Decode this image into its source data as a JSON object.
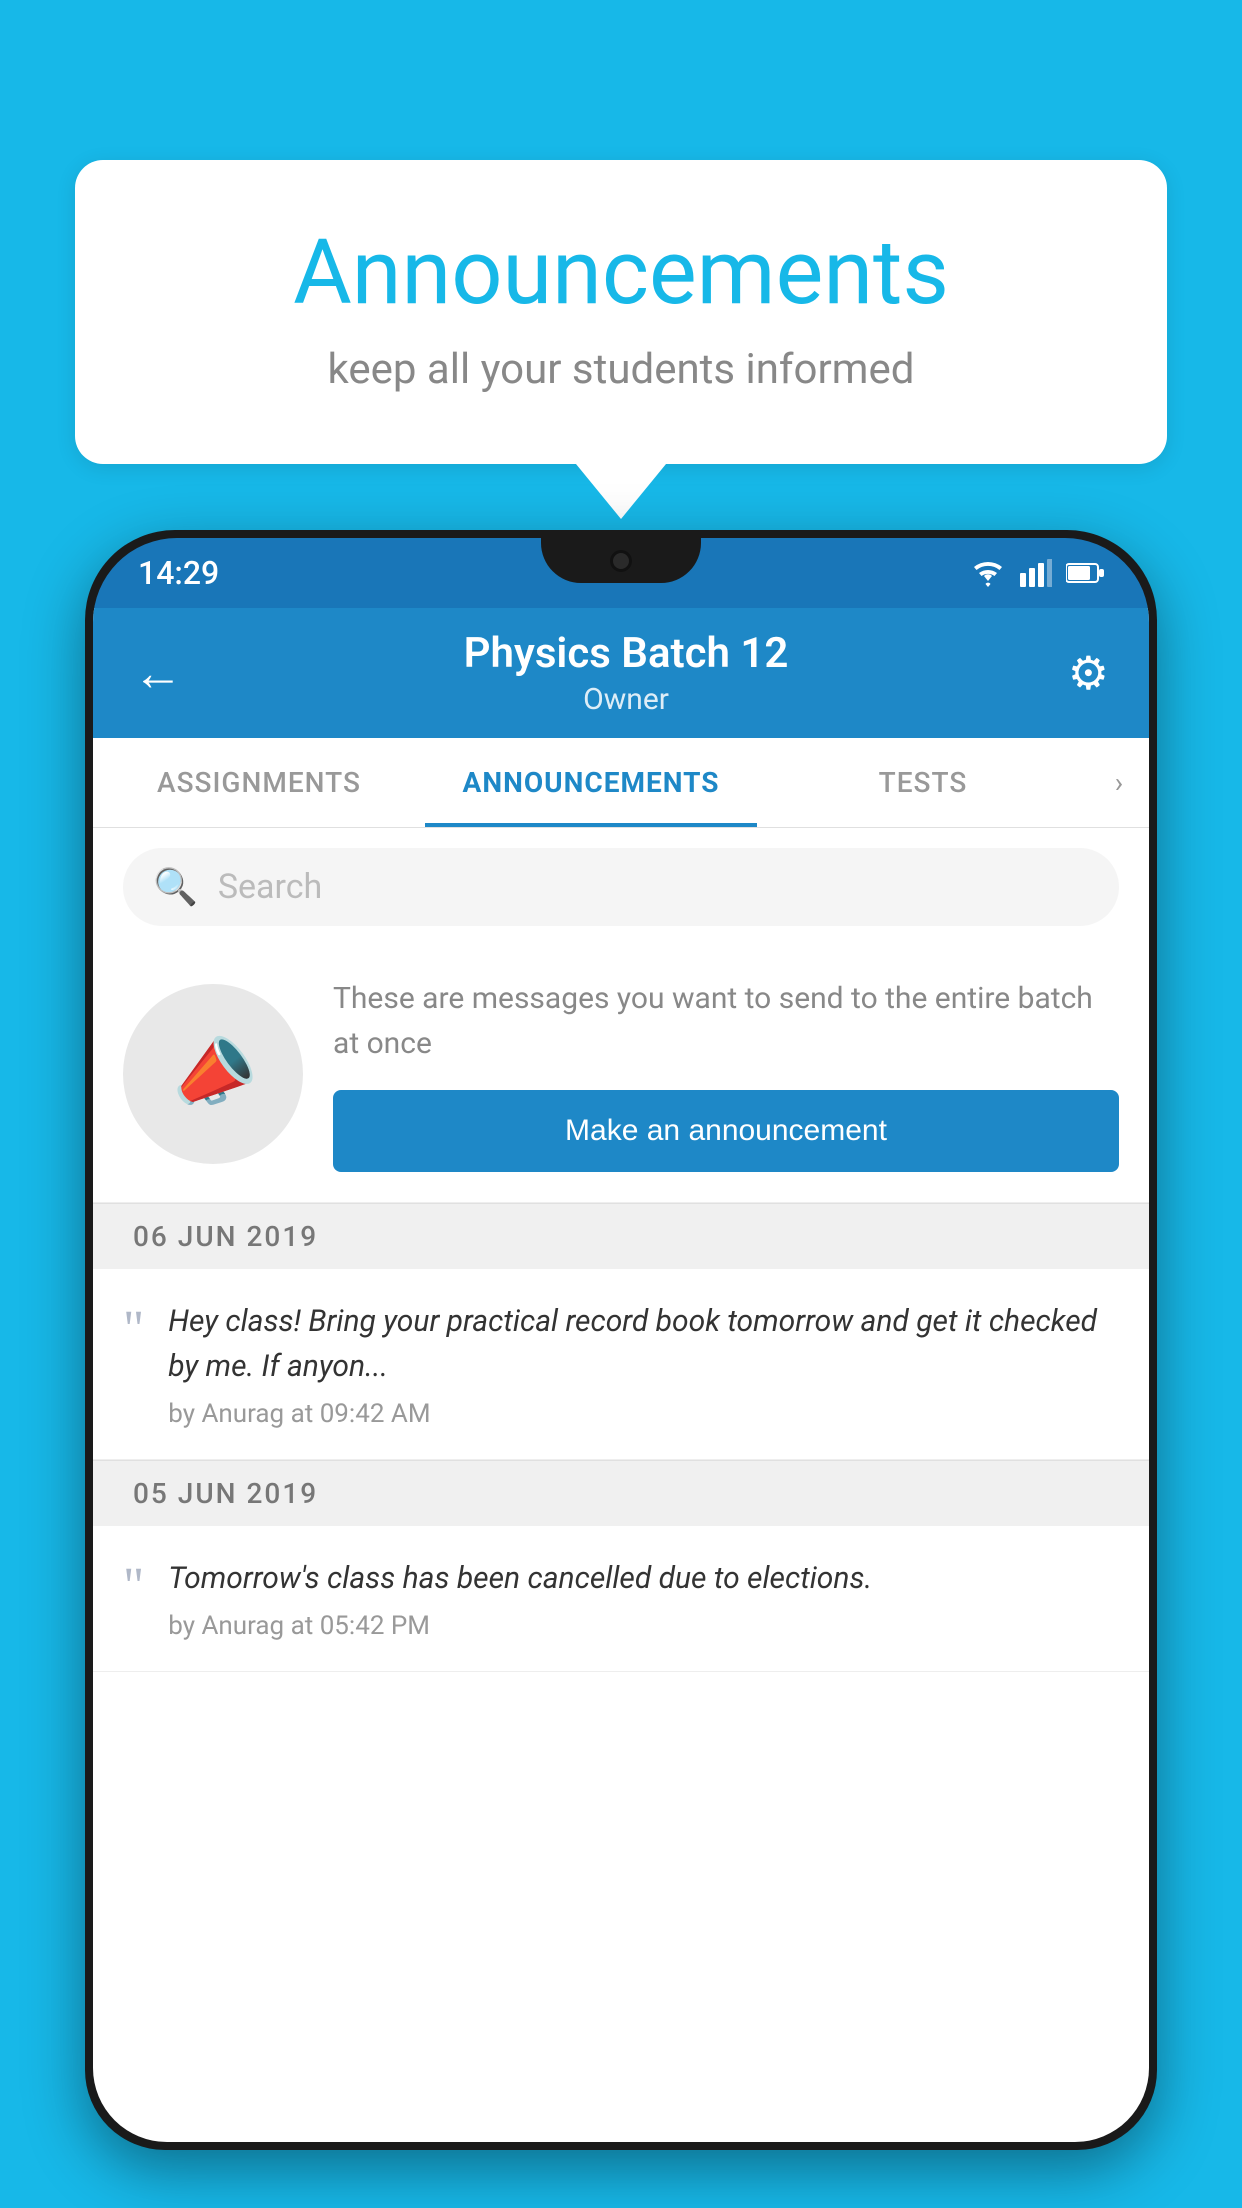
{
  "background_color": "#17b8e8",
  "speech_bubble": {
    "title": "Announcements",
    "subtitle": "keep all your students informed"
  },
  "phone": {
    "status_bar": {
      "time": "14:29",
      "icons": [
        "wifi",
        "signal",
        "battery"
      ]
    },
    "app_bar": {
      "title": "Physics Batch 12",
      "subtitle": "Owner",
      "back_label": "←",
      "settings_label": "⚙"
    },
    "tabs": [
      {
        "label": "ASSIGNMENTS",
        "active": false
      },
      {
        "label": "ANNOUNCEMENTS",
        "active": true
      },
      {
        "label": "TESTS",
        "active": false
      }
    ],
    "search": {
      "placeholder": "Search"
    },
    "promo": {
      "description": "These are messages you want to send to the entire batch at once",
      "button_label": "Make an announcement"
    },
    "announcements": [
      {
        "date": "06  JUN  2019",
        "text": "Hey class! Bring your practical record book tomorrow and get it checked by me. If anyon...",
        "meta": "by Anurag at 09:42 AM"
      },
      {
        "date": "05  JUN  2019",
        "text": "Tomorrow's class has been cancelled due to elections.",
        "meta": "by Anurag at 05:42 PM"
      }
    ]
  }
}
